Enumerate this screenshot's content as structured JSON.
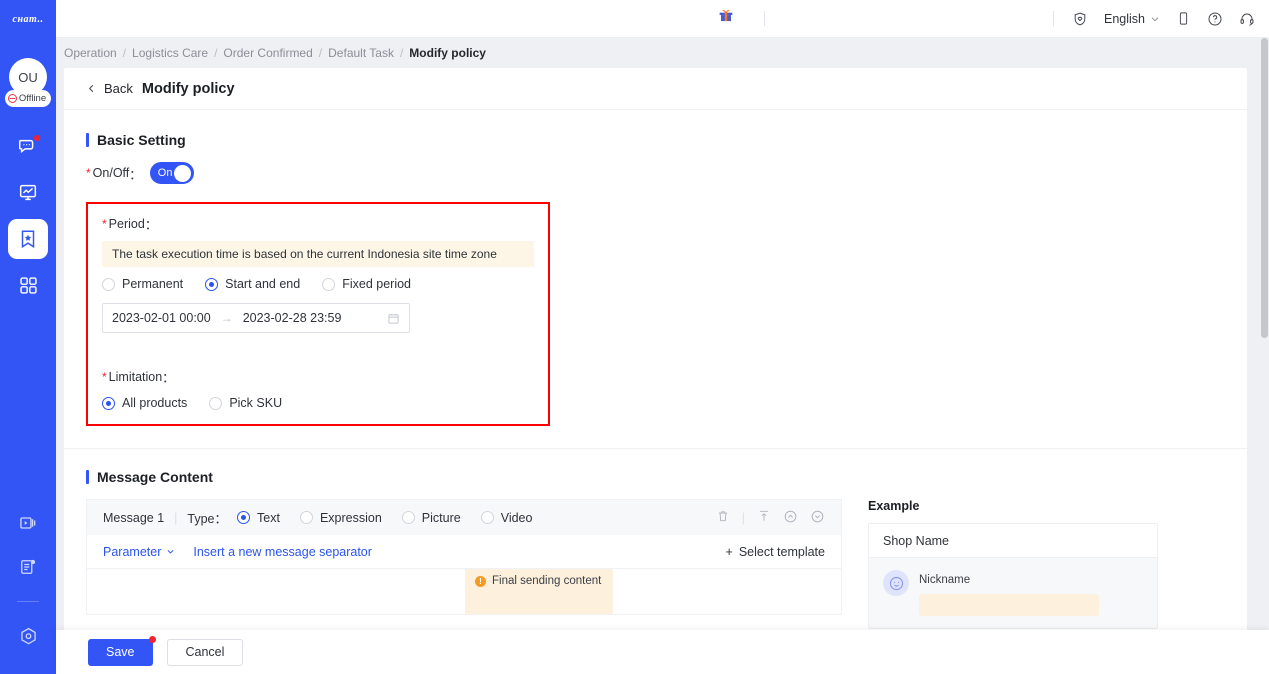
{
  "brand": {
    "logo_text": "cнaт.."
  },
  "sidebar": {
    "avatar_initials": "OU",
    "status_label": "Offline",
    "items": [
      {
        "name": "chat",
        "icon": "chat-bubble-icon",
        "badge": true,
        "active": false
      },
      {
        "name": "analytics",
        "icon": "monitor-chart-icon",
        "badge": false,
        "active": false
      },
      {
        "name": "marketing",
        "icon": "bookmark-star-icon",
        "badge": false,
        "active": true
      },
      {
        "name": "apps",
        "icon": "grid-apps-icon",
        "badge": false,
        "active": false
      }
    ],
    "bottom_items": [
      {
        "name": "video",
        "icon": "video-play-icon"
      },
      {
        "name": "docs",
        "icon": "document-icon"
      },
      {
        "name": "settings",
        "icon": "hexagon-settings-icon"
      }
    ]
  },
  "topbar": {
    "gift_icon": "gift-icon",
    "shield_icon": "shield-heart-icon",
    "language": "English",
    "mobile_icon": "mobile-phone-icon",
    "help_icon": "question-circle-icon",
    "support_icon": "headset-icon"
  },
  "breadcrumb": {
    "items": [
      "Operation",
      "Logistics Care",
      "Order Confirmed",
      "Default Task",
      "Modify policy"
    ],
    "separator": "/"
  },
  "page": {
    "back_label": "Back",
    "title": "Modify policy"
  },
  "basic_setting": {
    "section_title": "Basic Setting",
    "onoff_label": "On/Off",
    "onoff_value": "On",
    "required_mark": "*",
    "colon": "："
  },
  "period": {
    "label": "Period",
    "tip": "The task execution time is based on the current Indonesia site time zone",
    "options": [
      {
        "label": "Permanent",
        "selected": false
      },
      {
        "label": "Start and end",
        "selected": true
      },
      {
        "label": "Fixed period",
        "selected": false
      }
    ],
    "start": "2023-02-01 00:00",
    "range_arrow": "→",
    "end": "2023-02-28 23:59",
    "calendar_icon": "calendar-icon"
  },
  "limitation": {
    "label": "Limitation",
    "options": [
      {
        "label": "All products",
        "selected": true
      },
      {
        "label": "Pick SKU",
        "selected": false
      }
    ]
  },
  "message_content": {
    "section_title": "Message Content",
    "message_label": "Message 1",
    "pipe": "|",
    "type_label": "Type：",
    "types": [
      {
        "label": "Text",
        "selected": true
      },
      {
        "label": "Expression",
        "selected": false
      },
      {
        "label": "Picture",
        "selected": false
      },
      {
        "label": "Video",
        "selected": false
      }
    ],
    "tools": [
      {
        "name": "delete-icon"
      },
      {
        "name": "insert-top-icon"
      },
      {
        "name": "move-up-icon"
      },
      {
        "name": "move-down-icon"
      }
    ],
    "parameter_label": "Parameter",
    "separator_link": "Insert a new message separator",
    "select_template": "Select template",
    "select_template_plus": "+",
    "final_sending_content": "Final sending content"
  },
  "example": {
    "title": "Example",
    "shop_name": "Shop Name",
    "nickname": "Nickname"
  },
  "footer": {
    "save_label": "Save",
    "cancel_label": "Cancel"
  },
  "colors": {
    "brand_blue": "#3355f5",
    "radio_blue": "#2a54eb",
    "highlight_red": "#ff0000",
    "tip_bg": "#fdf6e7",
    "warn_orange": "#f59a23",
    "badge_red": "#f5222d"
  }
}
